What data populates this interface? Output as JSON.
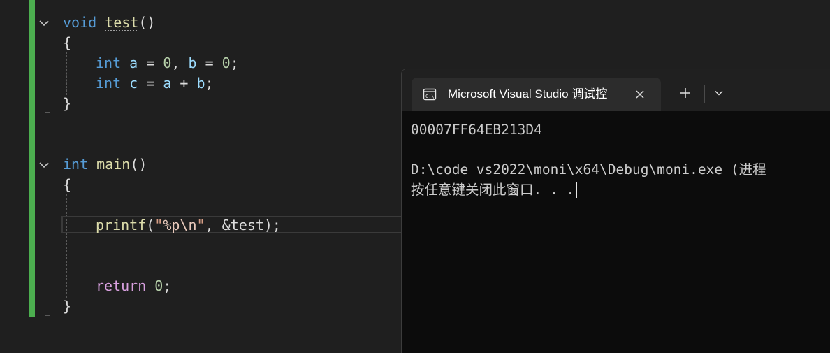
{
  "editor": {
    "lines": {
      "l1": {
        "kw": "void",
        "name": "test",
        "tail": "()"
      },
      "l2": {
        "text": "{"
      },
      "l3": {
        "kw": "int",
        "a": "a",
        "eq1": " = ",
        "n1": "0",
        "comma": ", ",
        "b": "b",
        "eq2": " = ",
        "n2": "0",
        "semi": ";"
      },
      "l4": {
        "kw": "int",
        "c": "c",
        "eq": " = ",
        "a": "a",
        "plus": " + ",
        "b": "b",
        "semi": ";"
      },
      "l5": {
        "text": "}"
      },
      "l6": {
        "kw": "int",
        "name": "main",
        "tail": "()"
      },
      "l7": {
        "text": "{"
      },
      "l8": {
        "fn": "printf",
        "open": "(",
        "str_open": "\"",
        "fmt": "%p",
        "esc": "\\n",
        "str_close": "\"",
        "rest": ", &test);"
      },
      "l9": {
        "kw": "return",
        "sp": " ",
        "n": "0",
        "semi": ";"
      },
      "l10": {
        "text": "}"
      }
    },
    "colors": {
      "change_bar": "#4cae4f",
      "background": "#1f1f1f"
    }
  },
  "terminal": {
    "tab_title": "Microsoft Visual Studio 调试控",
    "tab_icon": "console-icon",
    "close_icon": "close-icon",
    "new_tab_icon": "plus-icon",
    "dropdown_icon": "chevron-down-icon",
    "output": [
      "00007FF64EB213D4",
      "",
      "D:\\code vs2022\\moni\\x64\\Debug\\moni.exe (进程",
      "按任意键关闭此窗口. . ."
    ]
  }
}
